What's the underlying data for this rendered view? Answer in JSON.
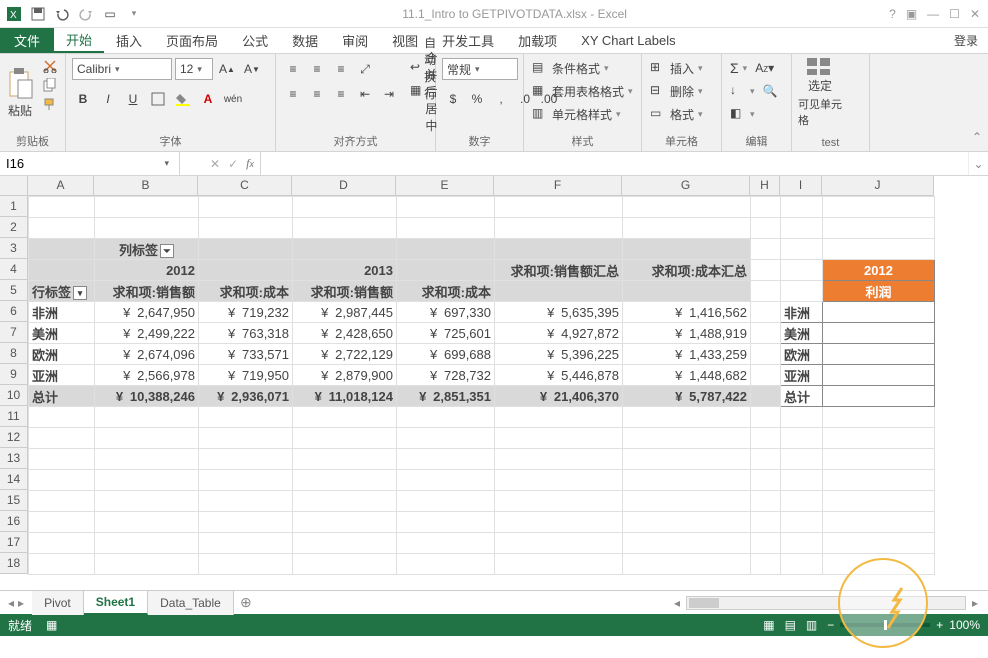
{
  "title": "11.1_Intro to GETPIVOTDATA.xlsx - Excel",
  "qat": {
    "save": "save",
    "undo": "undo",
    "redo": "redo",
    "more": "more"
  },
  "tabs": {
    "file": "文件",
    "items": [
      "开始",
      "插入",
      "页面布局",
      "公式",
      "数据",
      "审阅",
      "视图",
      "开发工具",
      "加载项",
      "XY Chart Labels"
    ],
    "active": 0,
    "login": "登录"
  },
  "ribbon": {
    "clipboard": {
      "label": "剪贴板",
      "paste": "粘贴"
    },
    "font": {
      "label": "字体",
      "name": "Calibri",
      "size": "12",
      "bold": "B",
      "italic": "I",
      "underline": "U"
    },
    "align": {
      "label": "对齐方式",
      "wrap": "自动换行",
      "merge": "合并后居中"
    },
    "number": {
      "label": "数字",
      "format": "常规"
    },
    "style": {
      "label": "样式",
      "condfmt": "条件格式",
      "tablefmt": "套用表格格式",
      "cellfmt": "单元格样式"
    },
    "cells": {
      "label": "单元格",
      "insert": "插入",
      "delete": "删除",
      "format": "格式"
    },
    "editing": {
      "label": "编辑"
    },
    "test": {
      "label": "test",
      "select": "选定",
      "visible": "可见单元格"
    }
  },
  "namebox": "I16",
  "columns": [
    "A",
    "B",
    "C",
    "D",
    "E",
    "F",
    "G",
    "H",
    "I",
    "J"
  ],
  "rows": [
    "1",
    "2",
    "3",
    "4",
    "5",
    "6",
    "7",
    "8",
    "9",
    "10",
    "11",
    "12",
    "13",
    "14",
    "15",
    "16",
    "17",
    "18"
  ],
  "pivot": {
    "colLabelsTitle": "列标签",
    "rowLabelsTitle": "行标签",
    "year1": "2012",
    "year2": "2013",
    "h_sales": "求和项:销售额",
    "h_cost": "求和项:成本",
    "h_sales_total": "求和项:销售额汇总",
    "h_cost_total": "求和项:成本汇总",
    "rows": [
      {
        "label": "非洲",
        "v": [
          "2,647,950",
          "719,232",
          "2,987,445",
          "697,330",
          "5,635,395",
          "1,416,562"
        ]
      },
      {
        "label": "美洲",
        "v": [
          "2,499,222",
          "763,318",
          "2,428,650",
          "725,601",
          "4,927,872",
          "1,488,919"
        ]
      },
      {
        "label": "欧洲",
        "v": [
          "2,674,096",
          "733,571",
          "2,722,129",
          "699,688",
          "5,396,225",
          "1,433,259"
        ]
      },
      {
        "label": "亚洲",
        "v": [
          "2,566,978",
          "719,950",
          "2,879,900",
          "728,732",
          "5,446,878",
          "1,448,682"
        ]
      }
    ],
    "total": {
      "label": "总计",
      "v": [
        "10,388,246",
        "2,936,071",
        "11,018,124",
        "2,851,351",
        "21,406,370",
        "5,787,422"
      ]
    }
  },
  "side": {
    "header_year": "2012",
    "header_profit": "利润",
    "rows": [
      "非洲",
      "美洲",
      "欧洲",
      "亚洲",
      "总计"
    ]
  },
  "sheets": {
    "items": [
      "Pivot",
      "Sheet1",
      "Data_Table"
    ],
    "active": 1
  },
  "status": {
    "ready": "就绪",
    "zoom": "100%"
  },
  "currency": "¥"
}
